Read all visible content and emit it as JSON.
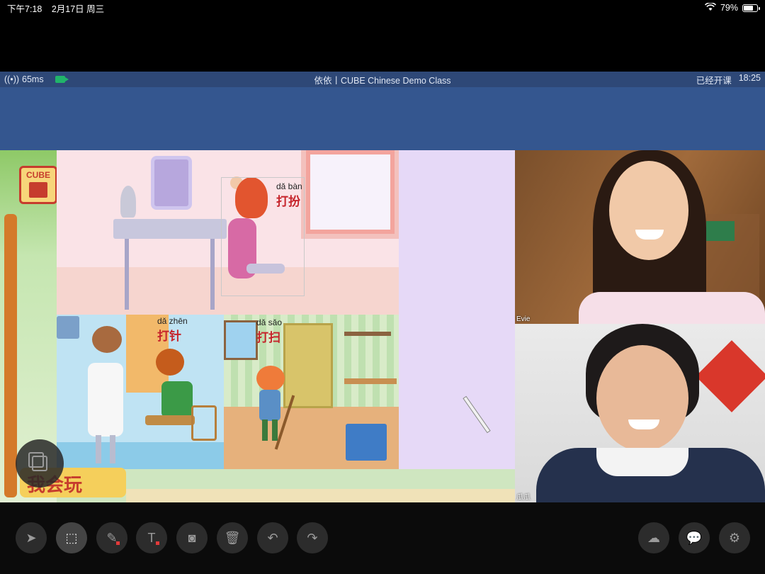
{
  "status_bar": {
    "time": "下午7:18",
    "date": "2月17日 周三",
    "battery": "79%",
    "battery_level": 0.79,
    "wifi_icon": "wifi-icon"
  },
  "app_bar": {
    "latency": "65ms",
    "title": "依依丨CUBE Chinese Demo Class",
    "elapsed_label": "已经开课",
    "elapsed_time": "18:25",
    "signal_icon": "signal-icon",
    "camera_icon": "camera-icon"
  },
  "board": {
    "logo_text": "CUBE",
    "banner_text": "我会玩",
    "scenes": [
      {
        "pinyin": "dǎ bàn",
        "hanzi": "打扮"
      },
      {
        "pinyin": "dǎ zhēn",
        "hanzi": "打针"
      },
      {
        "pinyin": "dǎ sǎo",
        "hanzi": "打扫"
      }
    ]
  },
  "videos": [
    {
      "name": "Evie"
    },
    {
      "name": "瓜瓜"
    }
  ],
  "toolbar": {
    "left": [
      {
        "name": "pointer-tool",
        "icon": "cursor-icon",
        "glyph": "➤"
      },
      {
        "name": "select-tool",
        "icon": "select-icon",
        "glyph": "⬚"
      },
      {
        "name": "pen-tool",
        "icon": "pen-icon",
        "glyph": "✎"
      },
      {
        "name": "text-tool",
        "icon": "text-icon",
        "glyph": "T"
      },
      {
        "name": "screenshot-tool",
        "icon": "camera-icon",
        "glyph": "◙"
      },
      {
        "name": "delete-tool",
        "icon": "trash-icon",
        "glyph": "🗑"
      },
      {
        "name": "undo-tool",
        "icon": "undo-icon",
        "glyph": "↶"
      },
      {
        "name": "redo-tool",
        "icon": "redo-icon",
        "glyph": "↷"
      }
    ],
    "right": [
      {
        "name": "cloud-button",
        "icon": "cloud-icon",
        "glyph": "☁"
      },
      {
        "name": "chat-button",
        "icon": "chat-icon",
        "glyph": "💬"
      },
      {
        "name": "settings-button",
        "icon": "gear-icon",
        "glyph": "⚙"
      }
    ]
  }
}
